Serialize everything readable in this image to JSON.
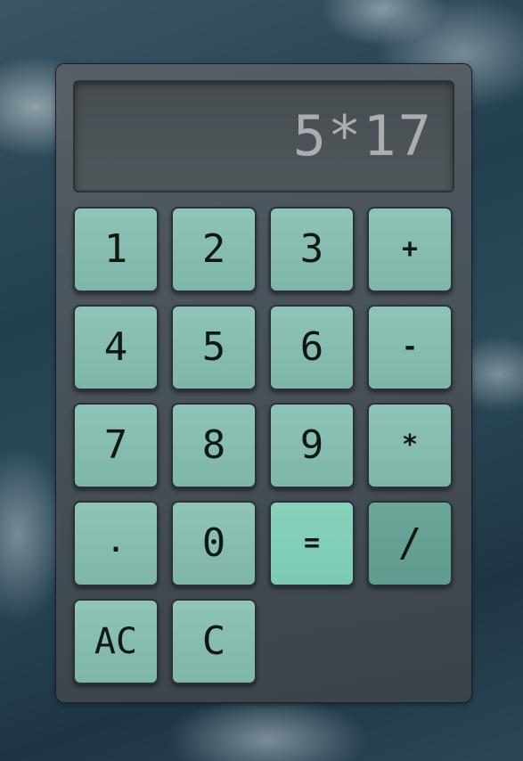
{
  "display": {
    "value": "5*17"
  },
  "keys": {
    "k1": "1",
    "k2": "2",
    "k3": "3",
    "plus": "+",
    "k4": "4",
    "k5": "5",
    "k6": "6",
    "minus": "-",
    "k7": "7",
    "k8": "8",
    "k9": "9",
    "multiply": "*",
    "dot": ".",
    "k0": "0",
    "equals": "=",
    "divide": "/",
    "all_clear": "AC",
    "clear": "C"
  },
  "colors": {
    "key_face": "#8fc4b8",
    "equals_face": "#87d2bd",
    "divide_face": "#6aa79a",
    "display_text": "#a9aeb0",
    "body": "#58606a"
  }
}
